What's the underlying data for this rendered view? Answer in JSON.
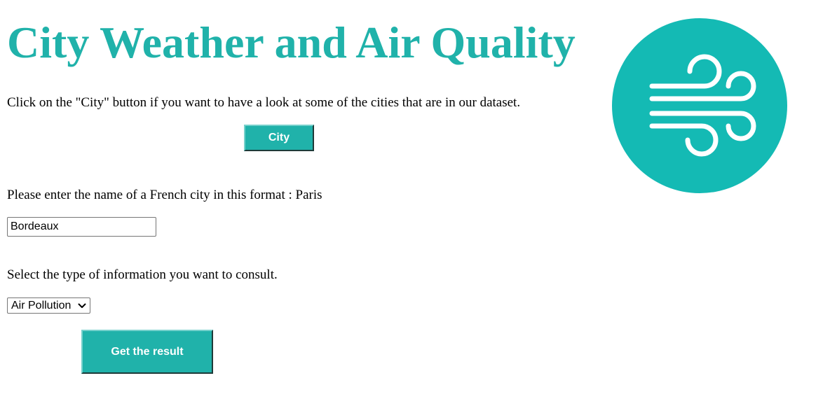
{
  "header": {
    "title": "City Weather and Air Quality"
  },
  "city_section": {
    "instruction": "Click on the \"City\" button if you want to have a look at some of the cities that are in our dataset.",
    "button_label": "City"
  },
  "search": {
    "instruction": "Please enter the name of a French city in this format : Paris",
    "value": "Bordeaux"
  },
  "info_type": {
    "instruction": "Select the type of information you want to consult.",
    "selected": "Air Pollution"
  },
  "submit": {
    "label": "Get the result"
  },
  "logo": {
    "icon": "wind-icon"
  },
  "colors": {
    "accent": "#20b2aa",
    "logo_circle": "#14bab4",
    "text": "#000000",
    "background": "#ffffff"
  }
}
